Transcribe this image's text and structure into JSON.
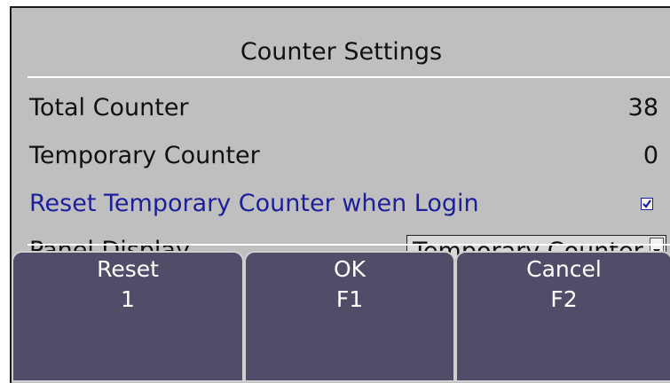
{
  "dialog": {
    "title": "Counter Settings"
  },
  "rows": {
    "total_counter": {
      "label": "Total Counter",
      "value": "38"
    },
    "temporary_counter": {
      "label": "Temporary Counter",
      "value": "0"
    },
    "reset_on_login": {
      "label": "Reset Temporary Counter when Login",
      "checked": true
    },
    "panel_display": {
      "label": "Panel Display",
      "selected": "Temporary Counter"
    }
  },
  "buttons": {
    "reset": {
      "label": "Reset",
      "key": "1"
    },
    "ok": {
      "label": "OK",
      "key": "F1"
    },
    "cancel": {
      "label": "Cancel",
      "key": "F2"
    }
  },
  "colors": {
    "background": "#bfbfbf",
    "button": "#504d68",
    "highlight_text": "#1c1f9a"
  }
}
